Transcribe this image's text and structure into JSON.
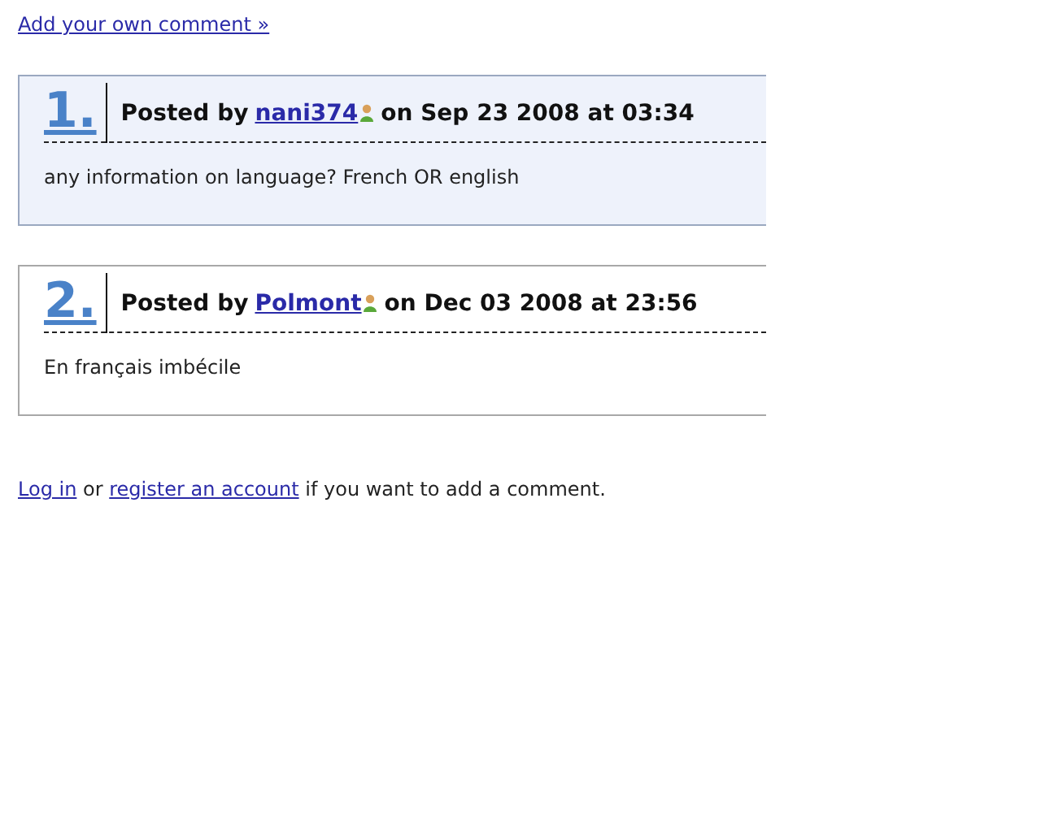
{
  "add_comment_link": "Add your own comment »",
  "comments": [
    {
      "number": "1.",
      "posted_by": "Posted by",
      "author": "nani374",
      "date": "on Sep 23 2008 at 03:34",
      "body": "any information on language? French OR english",
      "highlighted": true
    },
    {
      "number": "2.",
      "posted_by": "Posted by",
      "author": "Polmont",
      "date": "on Dec 03 2008 at 23:56",
      "body": "En français imbécile",
      "highlighted": false
    }
  ],
  "footer": {
    "login_link": "Log in",
    "or_text": "or",
    "register_link": "register an account",
    "rest": "if you want to add a comment."
  }
}
